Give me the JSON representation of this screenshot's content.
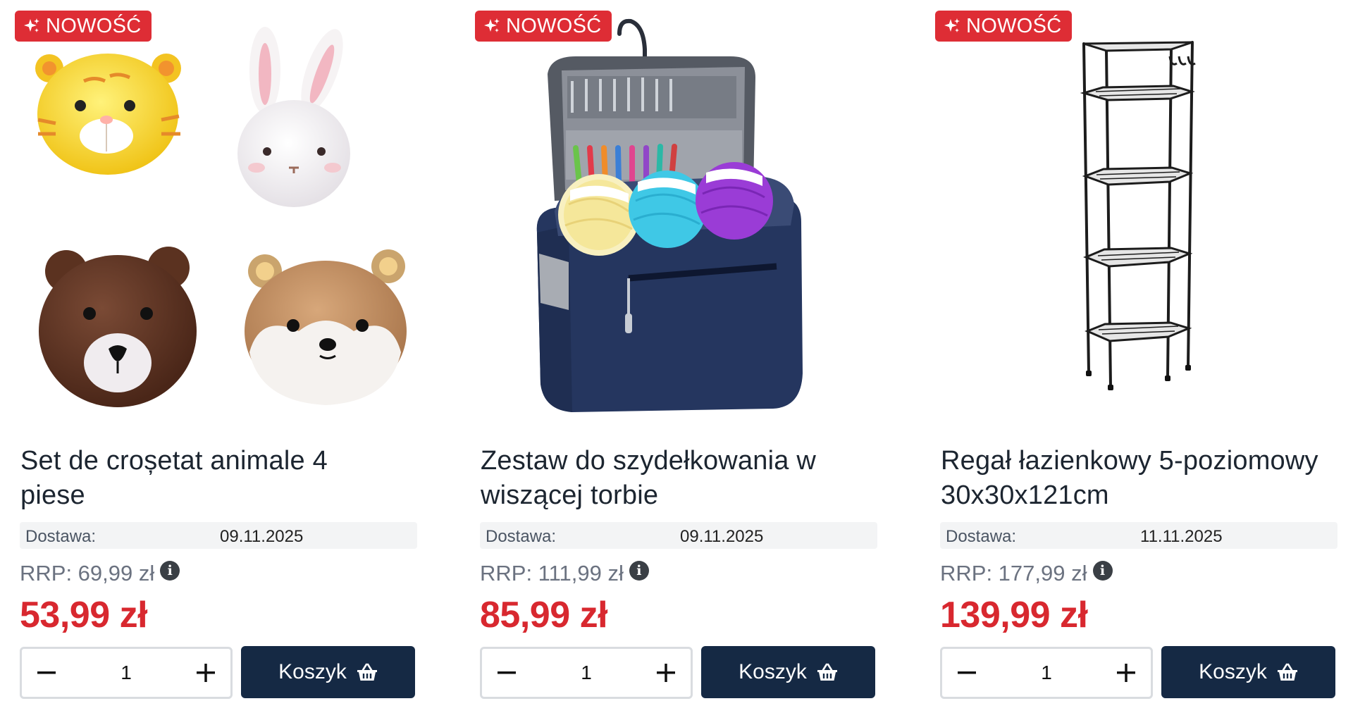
{
  "products": [
    {
      "badge": "NOWOŚĆ",
      "image_icon": "crochet-animals-image",
      "title_line1": "Set de croșetat animale 4",
      "title_line2": "piese",
      "delivery_label": "Dostawa:",
      "delivery_date": "09.11.2025",
      "rrp": "RRP: 69,99 zł",
      "price": "53,99 zł",
      "quantity": "1",
      "cart_label": "Koszyk"
    },
    {
      "badge": "NOWOŚĆ",
      "image_icon": "crochet-bag-image",
      "title_line1": "Zestaw do szydełkowania w",
      "title_line2": "wiszącej torbie",
      "delivery_label": "Dostawa:",
      "delivery_date": "09.11.2025",
      "rrp": "RRP: 111,99 zł",
      "price": "85,99 zł",
      "quantity": "1",
      "cart_label": "Koszyk"
    },
    {
      "badge": "NOWOŚĆ",
      "image_icon": "bathroom-shelf-image",
      "title_line1": "Regał łazienkowy 5-poziomowy",
      "title_line2": "30x30x121cm",
      "delivery_label": "Dostawa:",
      "delivery_date": "11.11.2025",
      "rrp": "RRP: 177,99 zł",
      "price": "139,99 zł",
      "quantity": "1",
      "cart_label": "Koszyk"
    }
  ],
  "colors": {
    "badge": "#de2d35",
    "price": "#d8282f",
    "cart_button": "#152944",
    "delivery_bg": "#f3f4f5"
  }
}
